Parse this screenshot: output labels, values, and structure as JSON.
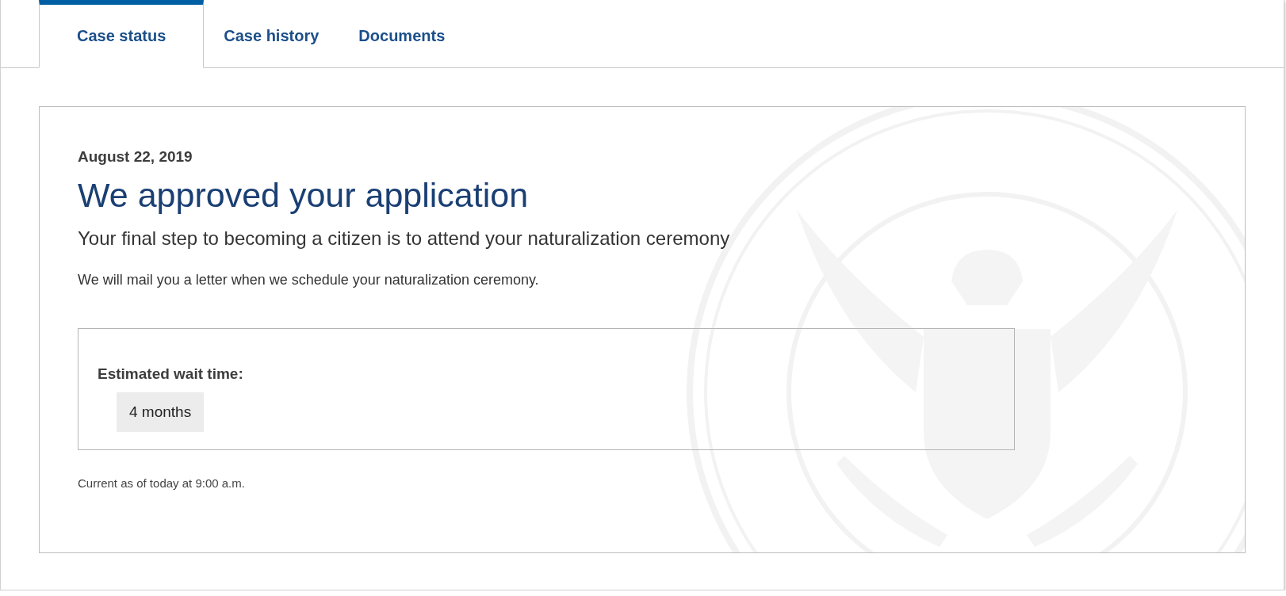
{
  "tabs": [
    {
      "label": "Case status",
      "selected": true
    },
    {
      "label": "Case history",
      "selected": false
    },
    {
      "label": "Documents",
      "selected": false
    }
  ],
  "status": {
    "date": "August 22, 2019",
    "heading": "We approved your application",
    "subheading": "Your final step to becoming a citizen is to attend your naturalization ceremony",
    "message": "We will mail you a letter when we schedule your naturalization ceremony.",
    "wait": {
      "label": "Estimated wait time:",
      "value": "4 months"
    },
    "updated": "Current as of today at 9:00 a.m."
  }
}
